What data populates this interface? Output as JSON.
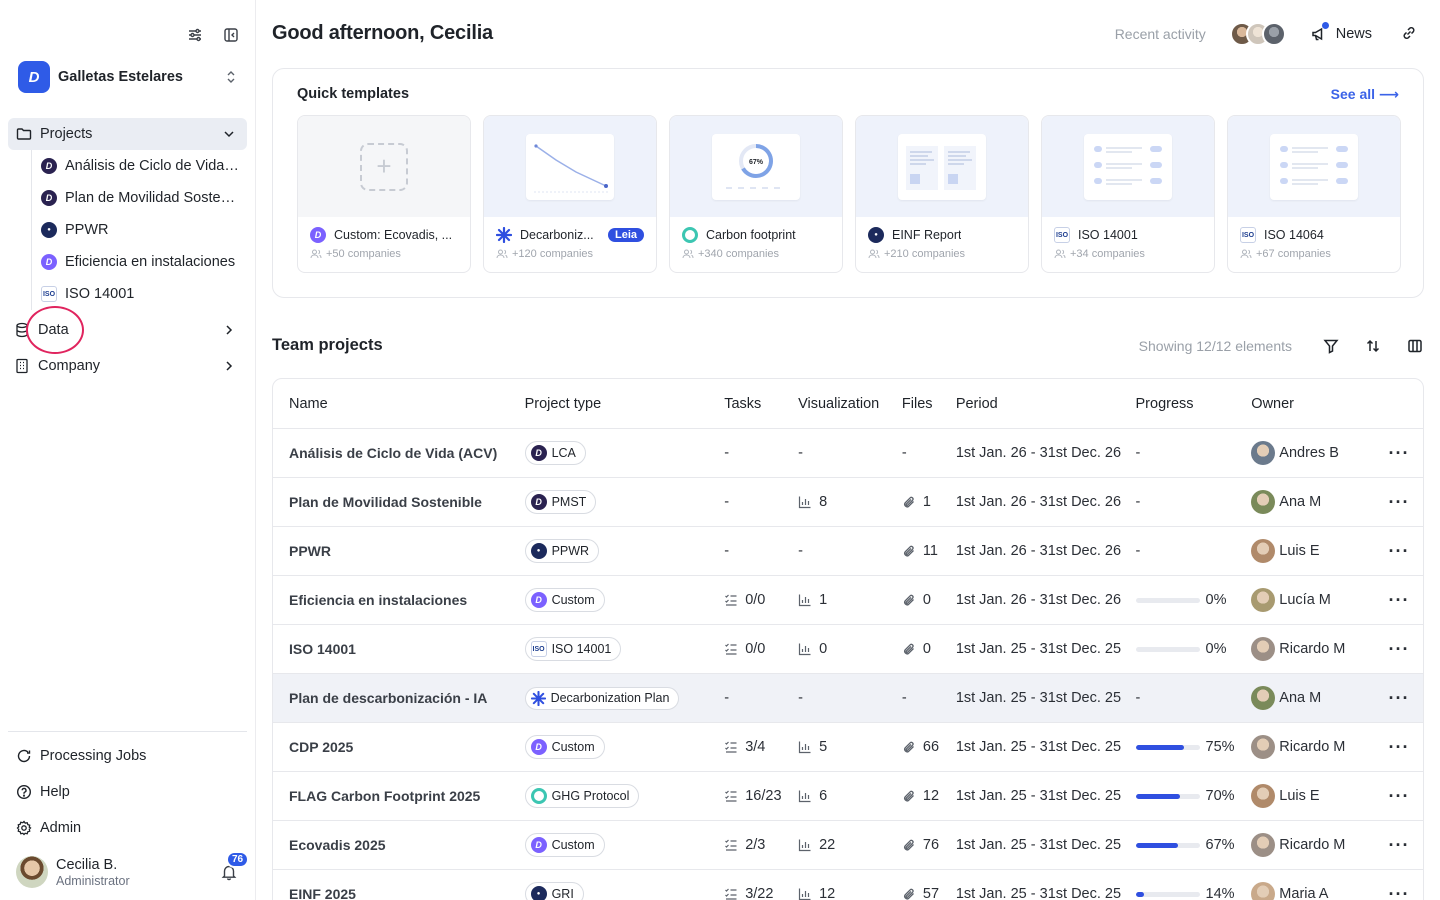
{
  "org": {
    "name": "Galletas Estelares"
  },
  "nav": {
    "projects_label": "Projects",
    "projects": [
      {
        "label": "Análisis de Ciclo de Vida (ACV)",
        "icon": "dark"
      },
      {
        "label": "Plan de Movilidad Sostenible",
        "icon": "dark"
      },
      {
        "label": "PPWR",
        "icon": "navy"
      },
      {
        "label": "Eficiencia en instalaciones",
        "icon": "purple"
      },
      {
        "label": "ISO 14001",
        "icon": "iso"
      }
    ],
    "data_label": "Data",
    "company_label": "Company",
    "processing_label": "Processing Jobs",
    "help_label": "Help",
    "admin_label": "Admin"
  },
  "user": {
    "name": "Cecilia B.",
    "role": "Administrator",
    "notifications": "76"
  },
  "header": {
    "greeting": "Good afternoon, Cecilia",
    "recent": "Recent activity",
    "news": "News"
  },
  "templates": {
    "title": "Quick templates",
    "see_all": "See all",
    "items": [
      {
        "name": "Custom: Ecovadis, ...",
        "count": "+50 companies"
      },
      {
        "name": "Decarboniz...",
        "badge": "Leia",
        "count": "+120 companies"
      },
      {
        "name": "Carbon footprint",
        "count": "+340 companies",
        "gauge": "67%"
      },
      {
        "name": "EINF Report",
        "count": "+210 companies"
      },
      {
        "name": "ISO 14001",
        "count": "+34 companies"
      },
      {
        "name": "ISO 14064",
        "count": "+67 companies"
      }
    ]
  },
  "team": {
    "title": "Team projects",
    "showing": "Showing 12/12 elements",
    "columns": [
      "Name",
      "Project type",
      "Tasks",
      "Visualization",
      "Files",
      "Period",
      "Progress",
      "Owner"
    ],
    "rows": [
      {
        "name": "Análisis de Ciclo de Vida (ACV)",
        "type": "LCA",
        "type_icon": "dark",
        "tasks": "-",
        "vis": "-",
        "files": "-",
        "period": "1st Jan. 26 - 31st Dec. 26",
        "progress": "-",
        "owner": "Andres B",
        "av": "#6b7a8c"
      },
      {
        "name": "Plan de Movilidad Sostenible",
        "type": "PMST",
        "type_icon": "dark",
        "tasks": "-",
        "vis": "8",
        "files": "1",
        "period": "1st Jan. 26 - 31st Dec. 26",
        "progress": "-",
        "owner": "Ana M",
        "av": "#7a8a5a"
      },
      {
        "name": "PPWR",
        "type": "PPWR",
        "type_icon": "navy",
        "tasks": "-",
        "vis": "-",
        "files": "11",
        "period": "1st Jan. 26 - 31st Dec. 26",
        "progress": "-",
        "owner": "Luis E",
        "av": "#b08a6a"
      },
      {
        "name": "Eficiencia en instalaciones",
        "type": "Custom",
        "type_icon": "purple",
        "tasks": "0/0",
        "vis": "1",
        "files": "0",
        "period": "1st Jan. 26 - 31st Dec. 26",
        "progress": "0%",
        "progress_value": 0,
        "owner": "Lucía M",
        "av": "#a89a70"
      },
      {
        "name": "ISO 14001",
        "type": "ISO 14001",
        "type_icon": "iso",
        "tasks": "0/0",
        "vis": "0",
        "files": "0",
        "period": "1st Jan. 25 - 31st Dec. 25",
        "progress": "0%",
        "progress_value": 0,
        "owner": "Ricardo M",
        "av": "#9c8f86"
      },
      {
        "name": "Plan de descarbonización - IA",
        "type": "Decarbonization Plan",
        "type_icon": "decarb",
        "tasks": "-",
        "vis": "-",
        "files": "-",
        "period": "1st Jan. 25 - 31st Dec. 25",
        "progress": "-",
        "owner": "Ana M",
        "av": "#7a8a5a",
        "highlight": true
      },
      {
        "name": "CDP 2025",
        "type": "Custom",
        "type_icon": "purple",
        "tasks": "3/4",
        "vis": "5",
        "files": "66",
        "period": "1st Jan. 25 - 31st Dec. 25",
        "progress": "75%",
        "progress_value": 75,
        "owner": "Ricardo M",
        "av": "#9c8f86"
      },
      {
        "name": "FLAG Carbon Footprint 2025",
        "type": "GHG Protocol",
        "type_icon": "ghg",
        "tasks": "16/23",
        "vis": "6",
        "files": "12",
        "period": "1st Jan. 25 - 31st Dec. 25",
        "progress": "70%",
        "progress_value": 70,
        "owner": "Luis E",
        "av": "#b08a6a"
      },
      {
        "name": "Ecovadis 2025",
        "type": "Custom",
        "type_icon": "purple",
        "tasks": "2/3",
        "vis": "22",
        "files": "76",
        "period": "1st Jan. 25 - 31st Dec. 25",
        "progress": "67%",
        "progress_value": 67,
        "owner": "Ricardo M",
        "av": "#9c8f86"
      },
      {
        "name": "EINF 2025",
        "type": "GRI",
        "type_icon": "navy",
        "tasks": "3/22",
        "vis": "12",
        "files": "57",
        "period": "1st Jan. 25 - 31st Dec. 25",
        "progress": "14%",
        "progress_value": 14,
        "owner": "Maria A",
        "av": "#c9a98a"
      }
    ]
  },
  "colors": {
    "accent": "#2f5be7",
    "highlight_ring": "#e0245e",
    "progress": "#2f4fe0"
  }
}
